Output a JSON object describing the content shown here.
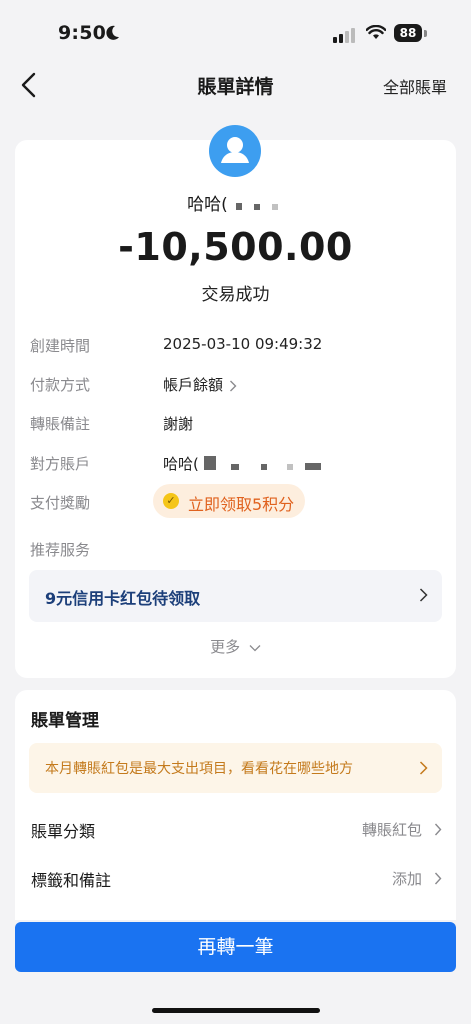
{
  "status_bar": {
    "time": "9:50",
    "battery": "88"
  },
  "nav": {
    "title": "賬單詳情",
    "right_link": "全部賬單"
  },
  "summary": {
    "payee": "哈哈(",
    "amount": "-10,500.00",
    "status": "交易成功"
  },
  "details": {
    "created_label": "創建時間",
    "created_value": "2025-03-10 09:49:32",
    "payment_label": "付款方式",
    "payment_value": "帳戶餘額",
    "memo_label": "轉賬備註",
    "memo_value": "謝謝",
    "account_label": "對方賬戶",
    "account_value": "哈哈(",
    "reward_label": "支付獎勵",
    "reward_value": "立即领取5积分",
    "services_label": "推荐服务"
  },
  "promo": {
    "text": "9元信用卡红包待领取"
  },
  "more": {
    "label": "更多"
  },
  "management": {
    "title": "賬單管理",
    "notice": "本月轉賬紅包是最大支出項目，看看花在哪些地方",
    "category_label": "賬單分類",
    "category_value": "轉賬紅包",
    "tags_label": "標籤和備註",
    "tags_value": "添加"
  },
  "action": {
    "button_label": "再轉一筆"
  },
  "colors": {
    "accent": "#1a73f1",
    "reward": "#e0621f",
    "notice": "#c47a1c"
  }
}
